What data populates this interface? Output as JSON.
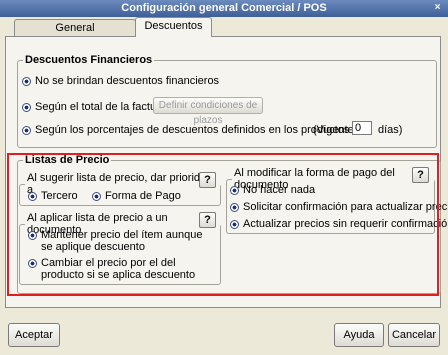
{
  "window": {
    "title": "Configuración general Comercial / POS",
    "close_icon": "×"
  },
  "tabs": [
    {
      "label": "General"
    },
    {
      "label": "Descuentos"
    }
  ],
  "descuentos_financieros": {
    "legend": "Descuentos Financieros",
    "option_none": "No se brindan descuentos financieros",
    "option_total": "Según el total de la factura",
    "define_button": "Definir condiciones de plazos",
    "option_percent": "Según los porcentajes de descuentos definidos en los productos",
    "vigente_label": "(Vigente",
    "vigente_value": "0",
    "dias_label": "días)"
  },
  "listas_precio": {
    "legend": "Listas de Precio",
    "prioridad": {
      "legend": "Al sugerir lista de precio, dar prioridad a",
      "tercero": "Tercero",
      "forma_pago": "Forma de Pago",
      "help": "?"
    },
    "aplicar": {
      "legend": "Al aplicar lista de precio a un documento",
      "mantener": "Mantener precio del ítem aunque se aplique descuento",
      "cambiar": "Cambiar el precio por el del producto si se aplica descuento",
      "help": "?"
    },
    "modificar": {
      "legend": "Al modificar la forma de pago del documento",
      "nada": "No hacer nada",
      "solicitar": "Solicitar confirmación para actualizar precios",
      "actualizar": "Actualizar precios sin requerir confirmación",
      "help": "?"
    }
  },
  "footer": {
    "aceptar": "Aceptar",
    "ayuda": "Ayuda",
    "cancelar": "Cancelar"
  }
}
